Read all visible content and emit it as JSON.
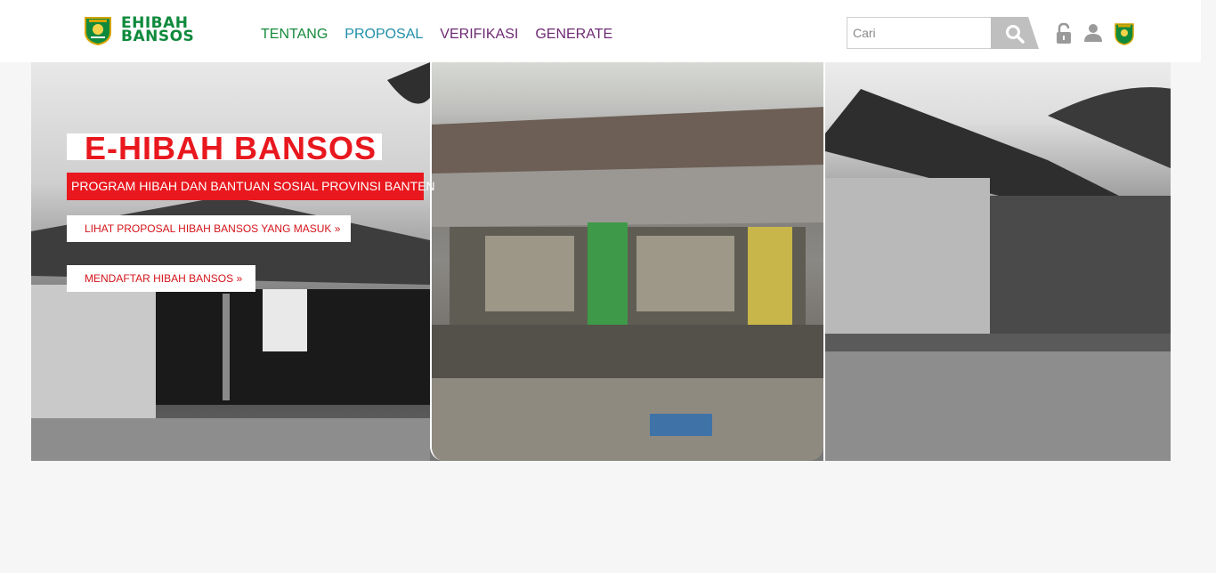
{
  "brand": {
    "line1": "EHIBAH",
    "line2": "BANSOS",
    "emblem_icon": "banten-emblem-icon",
    "green": "#0f8a3c"
  },
  "nav": {
    "items": [
      {
        "label": "TENTANG",
        "color": "#168a3a"
      },
      {
        "label": "PROPOSAL",
        "color": "#1f8fa8"
      },
      {
        "label": "VERIFIKASI",
        "color": "#6e2a73"
      },
      {
        "label": "GENERATE",
        "color": "#6e2a73"
      }
    ]
  },
  "search": {
    "placeholder": "Cari",
    "value": "",
    "icon": "search-icon"
  },
  "header_icons": [
    "lock-icon",
    "user-icon",
    "banten-emblem-icon"
  ],
  "hero": {
    "title": "E-HIBAH BANSOS",
    "subtitle": "PROGRAM HIBAH DAN BANTUAN SOSIAL PROVINSI BANTEN",
    "button1": "LIHAT PROPOSAL HIBAH BANSOS YANG MASUK »",
    "button2": "MENDAFTAR HIBAH BANSOS »",
    "accent": "#e8181e"
  }
}
